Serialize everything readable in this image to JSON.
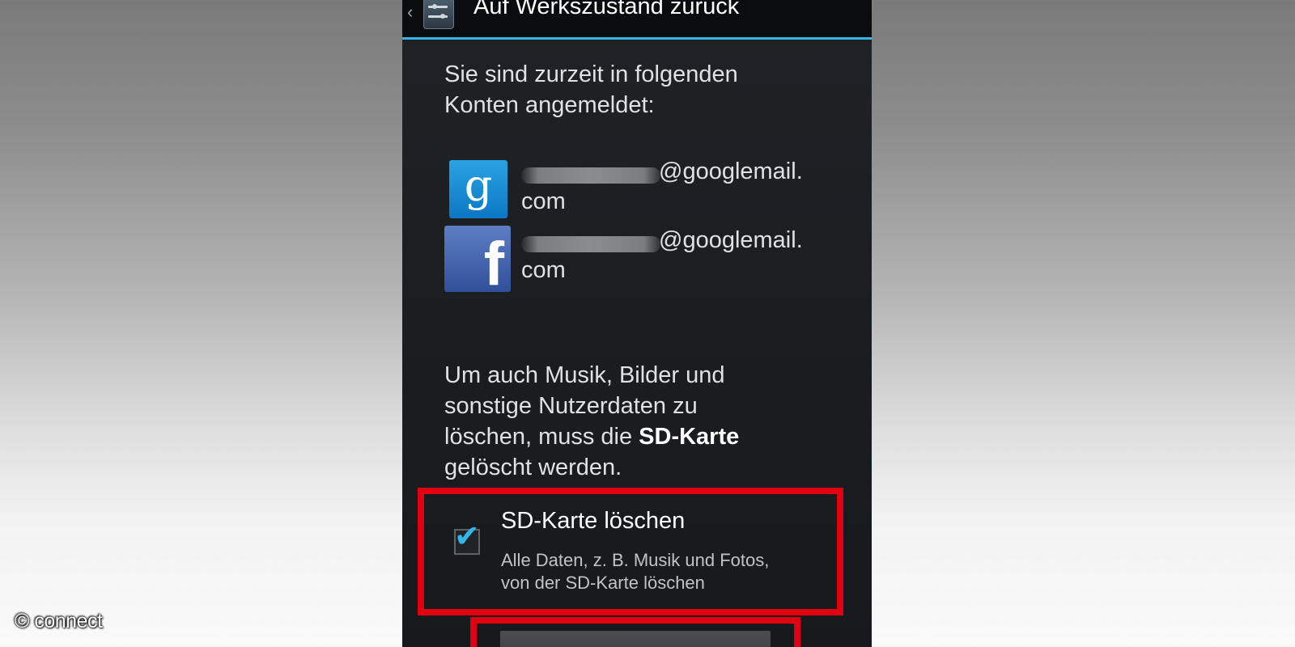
{
  "header": {
    "title": "Auf Werkszustand zurück",
    "back_icon": "chevron-left-icon",
    "app_icon": "settings-sliders-icon"
  },
  "intro": {
    "line1": "Sie sind zurzeit in folgenden",
    "line2": "Konten angemeldet:"
  },
  "accounts": [
    {
      "icon": "google-icon",
      "glyph": "g",
      "domain": "@googlemail.",
      "suffix": "com"
    },
    {
      "icon": "facebook-icon",
      "glyph": "f",
      "domain": "@googlemail.",
      "suffix": "com"
    }
  ],
  "info": {
    "line1": "Um auch Musik, Bilder und",
    "line2": "sonstige Nutzerdaten zu",
    "line3_prefix": "löschen, muss die ",
    "line3_bold": "SD-Karte",
    "line4": "gelöscht werden."
  },
  "sd_option": {
    "title": "SD-Karte löschen",
    "summary_line1": "Alle Daten, z. B. Musik und Fotos,",
    "summary_line2": "von der SD-Karte löschen",
    "checked": true,
    "checkmark": "✔"
  },
  "watermark": "© connect",
  "colors": {
    "accent": "#33b5e5",
    "highlight": "#e00010",
    "background": "#1c1e21"
  }
}
